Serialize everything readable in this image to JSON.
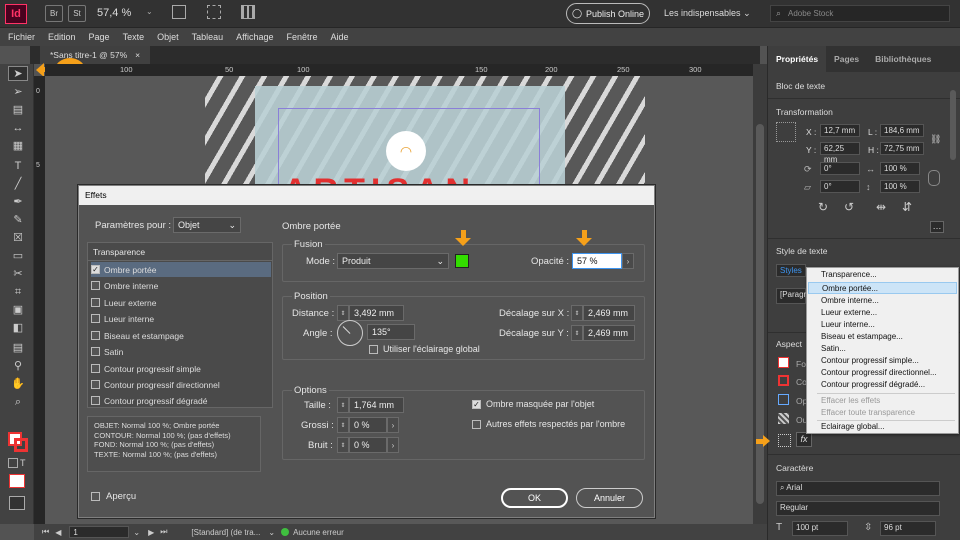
{
  "app": {
    "icon_label": "Id",
    "br_label": "Br",
    "st_label": "St",
    "zoom": "57,4 %",
    "publish_label": "Publish Online",
    "workspace": "Les indispensables",
    "search_placeholder": "Adobe Stock"
  },
  "menu": [
    "Fichier",
    "Edition",
    "Page",
    "Texte",
    "Objet",
    "Tableau",
    "Affichage",
    "Fenêtre",
    "Aide"
  ],
  "document": {
    "tab_title": "*Sans titre-1 @ 57%",
    "close": "×",
    "step_badge": "20",
    "ruler_h": [
      "100",
      "50",
      "100",
      "150",
      "200",
      "250",
      "300"
    ],
    "ruler_v": [
      "0",
      "5",
      "1\n0\n0",
      "1\n5\n0",
      "2\n0\n0",
      "2\n5\n0"
    ],
    "headline": "ARTISAN"
  },
  "status": {
    "page": "1",
    "style": "[Standard] (de tra...",
    "errors": "Aucune erreur"
  },
  "dialog": {
    "title": "Effets",
    "params_label": "Paramètres pour :",
    "params_value": "Objet",
    "transparency_header": "Transparence",
    "effects": [
      {
        "label": "Ombre portée",
        "checked": true,
        "selected": true
      },
      {
        "label": "Ombre interne",
        "checked": false
      },
      {
        "label": "Lueur externe",
        "checked": false
      },
      {
        "label": "Lueur interne",
        "checked": false
      },
      {
        "label": "Biseau et estampage",
        "checked": false
      },
      {
        "label": "Satin",
        "checked": false
      },
      {
        "label": "Contour progressif simple",
        "checked": false
      },
      {
        "label": "Contour progressif directionnel",
        "checked": false
      },
      {
        "label": "Contour progressif dégradé",
        "checked": false
      }
    ],
    "summary": [
      "OBJET: Normal 100 %; Ombre portée",
      "CONTOUR: Normal 100 %; (pas d'effets)",
      "FOND: Normal 100 %; (pas d'effets)",
      "TEXTE: Normal 100 %; (pas d'effets)"
    ],
    "preview_label": "Aperçu",
    "section_title": "Ombre portée",
    "fusion": {
      "legend": "Fusion",
      "mode_label": "Mode :",
      "mode_value": "Produit",
      "color": "#33dd00",
      "opacity_label": "Opacité :",
      "opacity_value": "57 %"
    },
    "position": {
      "legend": "Position",
      "distance_label": "Distance :",
      "distance_value": "3,492 mm",
      "angle_label": "Angle :",
      "angle_value": "135°",
      "global_light_label": "Utiliser l'éclairage global",
      "offset_x_label": "Décalage sur X :",
      "offset_x_value": "2,469 mm",
      "offset_y_label": "Décalage sur Y :",
      "offset_y_value": "2,469 mm"
    },
    "options": {
      "legend": "Options",
      "size_label": "Taille :",
      "size_value": "1,764 mm",
      "noise_label": "Grossi :",
      "noise_value": "0 %",
      "spread_label": "Bruit :",
      "spread_value": "0 %",
      "knockout_label": "Ombre masquée par l'objet",
      "honor_label": "Autres effets respectés par l'ombre"
    },
    "ok_label": "OK",
    "cancel_label": "Annuler"
  },
  "panel": {
    "tabs": [
      "Propriétés",
      "Pages",
      "Bibliothèques"
    ],
    "object_type": "Bloc de texte",
    "transform_title": "Transformation",
    "x_label": "X :",
    "x_value": "12,7 mm",
    "y_label": "Y :",
    "y_value": "62,25 mm",
    "l_label": "L :",
    "l_value": "184,6 mm",
    "h_label": "H :",
    "h_value": "72,75 mm",
    "rot_value": "0°",
    "shear_value": "0°",
    "scale_x_value": "100 %",
    "scale_y_value": "100 %",
    "text_style_title": "Style de texte",
    "styles_value": "Styles",
    "para_value": "[Paragr",
    "aspect_title": "Aspect",
    "aspect_fo": "Fo",
    "aspect_co": "Co",
    "aspect_op": "Op",
    "aspect_ou": "Ou",
    "character_title": "Caractère",
    "font_value": "Arial",
    "weight_value": "Regular",
    "size_value": "100 pt",
    "leading_value": "96 pt"
  },
  "context_menu": {
    "items": [
      {
        "label": "Transparence...",
        "state": "normal"
      },
      {
        "label": "Ombre portée...",
        "state": "highlight"
      },
      {
        "label": "Ombre interne...",
        "state": "normal"
      },
      {
        "label": "Lueur externe...",
        "state": "normal"
      },
      {
        "label": "Lueur interne...",
        "state": "normal"
      },
      {
        "label": "Biseau et estampage...",
        "state": "normal"
      },
      {
        "label": "Satin...",
        "state": "normal"
      },
      {
        "label": "Contour progressif simple...",
        "state": "normal"
      },
      {
        "label": "Contour progressif directionnel...",
        "state": "normal"
      },
      {
        "label": "Contour progressif dégradé...",
        "state": "normal"
      },
      {
        "label": "Effacer les effets",
        "state": "disabled"
      },
      {
        "label": "Effacer toute transparence",
        "state": "disabled"
      },
      {
        "label": "Eclairage global...",
        "state": "normal"
      }
    ]
  },
  "colors": {
    "accent": "#f5a01a",
    "brand": "#ff3366"
  }
}
